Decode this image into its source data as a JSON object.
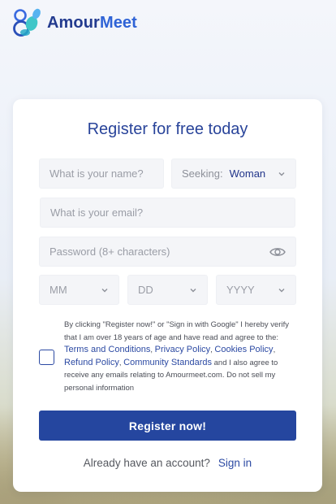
{
  "brand": {
    "name_part1": "Amour",
    "name_part2": "Meet",
    "logo_icon": "amourmeet-logo-icon"
  },
  "form": {
    "title": "Register for free today",
    "name_placeholder": "What is your name?",
    "seeking_label": "Seeking:",
    "seeking_value": "Woman",
    "email_placeholder": "What is your email?",
    "password_placeholder": "Password (8+ characters)",
    "month_placeholder": "MM",
    "day_placeholder": "DD",
    "year_placeholder": "YYYY",
    "terms": {
      "part1": "By clicking \"Register now!\" or \"Sign in with Google\" I hereby verify that I am over 18 years of age and have read and agree to the: ",
      "terms_link": "Terms and Conditions",
      "privacy_link": "Privacy Policy",
      "cookies_link": "Cookies Policy",
      "refund_link": "Refund Policy",
      "community_link": "Community Standards",
      "part2": " and I also agree to receive any emails relating to Amourmeet.com. Do not sell my personal information"
    },
    "submit_label": "Register now!",
    "account_prompt": "Already have an account?",
    "signin_link": "Sign in"
  },
  "colors": {
    "primary": "#25469f",
    "title": "#29449a",
    "link": "#2c4aa3"
  }
}
